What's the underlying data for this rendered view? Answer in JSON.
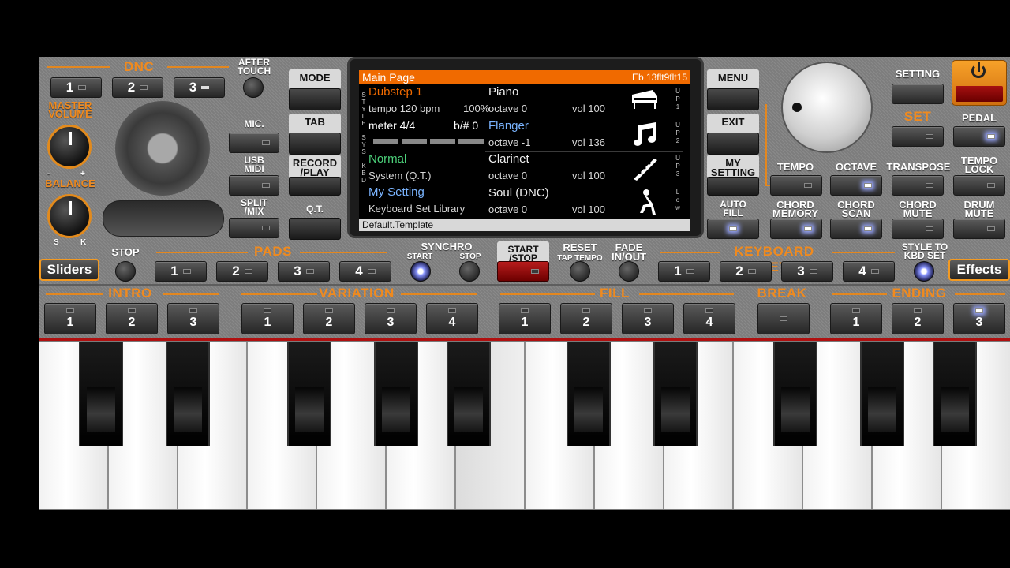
{
  "dnc": {
    "title": "DNC",
    "btn1": "1",
    "btn2": "2",
    "btn3": "3",
    "aftertouch_l1": "AFTER",
    "aftertouch_l2": "TOUCH"
  },
  "labels": {
    "master_l1": "MASTER",
    "master_l2": "VOLUME",
    "balance": "BALANCE",
    "bal_s": "S",
    "bal_k": "K",
    "minus": "-",
    "plus": "+",
    "mic": "MIC.",
    "usb_l1": "USB",
    "usb_l2": "MIDI",
    "split_l1": "SPLIT",
    "split_l2": "/MIX",
    "mode": "MODE",
    "tab": "TAB",
    "record_l1": "RECORD",
    "record_l2": "/PLAY",
    "qt": "Q.T.",
    "menu": "MENU",
    "exit": "EXIT",
    "mysetting_l1": "MY",
    "mysetting_l2": "SETTING",
    "autofill_l1": "AUTO",
    "autofill_l2": "FILL",
    "setting": "SETTING",
    "set": "SET",
    "pedal": "PEDAL",
    "tempo": "TEMPO",
    "octave": "OCTAVE",
    "transpose": "TRANSPOSE",
    "tempolock_l1": "TEMPO",
    "tempolock_l2": "LOCK",
    "chordmem_l1": "CHORD",
    "chordmem_l2": "MEMORY",
    "chordscan_l1": "CHORD",
    "chordscan_l2": "SCAN",
    "chordmute_l1": "CHORD",
    "chordmute_l2": "MUTE",
    "drummute_l1": "DRUM",
    "drummute_l2": "MUTE"
  },
  "screen": {
    "header": "Main Page",
    "header_right": "Eb 13flt9flt15",
    "style_name": "Dubstep 1",
    "tempo": "tempo 120 bpm",
    "pct": "100%",
    "meter": "meter 4/4",
    "bsharp": "b/#  0",
    "sys_name": "Normal",
    "sys_sub": "System (Q.T.)",
    "kbd_name": "My Setting",
    "kbd_sub": "Keyboard Set Library",
    "footer": "Default.Template",
    "side_left": [
      "S",
      "T",
      "Y",
      "L",
      "E",
      "",
      "S",
      "Y",
      "S",
      "",
      "K",
      "B",
      "D"
    ],
    "parts": [
      {
        "name": "Piano",
        "octave": "octave  0",
        "vol": "vol 100",
        "tag": [
          "U",
          "P",
          "1"
        ],
        "icon": "piano-icon"
      },
      {
        "name": "Flanger",
        "octave": "octave -1",
        "vol": "vol 136",
        "tag": [
          "U",
          "P",
          "2"
        ],
        "icon": "music-note-icon"
      },
      {
        "name": "Clarinet",
        "octave": "octave  0",
        "vol": "vol 100",
        "tag": [
          "U",
          "P",
          "3"
        ],
        "icon": "clarinet-icon"
      },
      {
        "name": "Soul (DNC)",
        "octave": "octave  0",
        "vol": "vol 100",
        "tag": [
          "L",
          "o",
          "w"
        ],
        "icon": "dancer-icon"
      }
    ]
  },
  "middle": {
    "sliders": "Sliders",
    "effects": "Effects",
    "stop": "STOP",
    "pads": "PADS",
    "pad1": "1",
    "pad2": "2",
    "pad3": "3",
    "pad4": "4",
    "synchro": "SYNCHRO",
    "synchro_start": "START",
    "synchro_stop": "STOP",
    "startstop_l1": "START",
    "startstop_l2": "/STOP",
    "reset_l1": "RESET",
    "reset_l2": "TAP TEMPO",
    "fade_l1": "FADE",
    "fade_l2": "IN/OUT",
    "kbdset": "KEYBOARD SET",
    "kbd1": "1",
    "kbd2": "2",
    "kbd3": "3",
    "kbd4": "4",
    "stylekbd_l1": "STYLE TO",
    "stylekbd_l2": "KBD SET"
  },
  "sections": {
    "intro": "INTRO",
    "variation": "VARIATION",
    "fill": "FILL",
    "break": "BREAK",
    "ending": "ENDING",
    "intro_btns": [
      "1",
      "2",
      "3"
    ],
    "variation_btns": [
      "1",
      "2",
      "3",
      "4"
    ],
    "fill_btns": [
      "1",
      "2",
      "3",
      "4"
    ],
    "ending_btns": [
      "1",
      "2",
      "3"
    ]
  },
  "colors": {
    "accent": "#f08a1e",
    "screen_header": "#f06a00",
    "lit": "#9aa8ff"
  }
}
